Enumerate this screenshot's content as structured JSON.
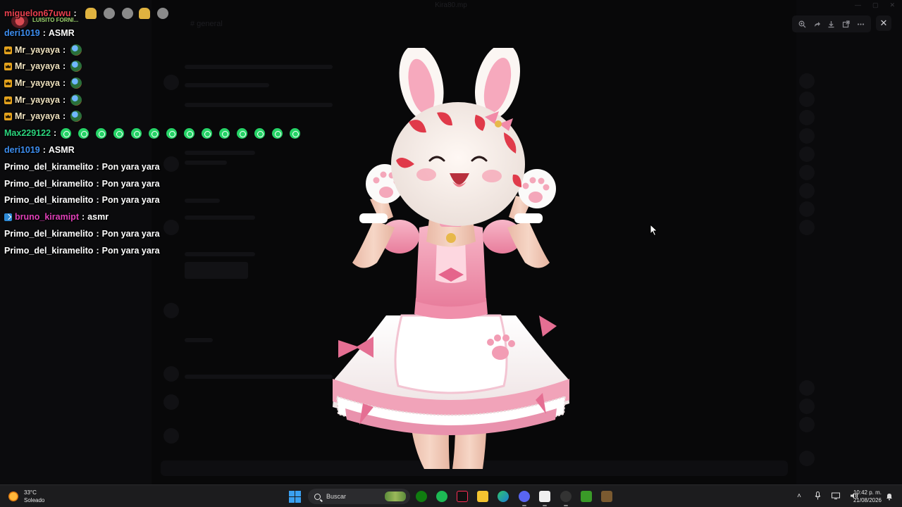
{
  "window": {
    "title": "Kira80.mp",
    "channel": "# general"
  },
  "viewer": {
    "close_glyph": "✕"
  },
  "chat": {
    "top_label": "LUISITO FORNI...",
    "top_user": "miguelon67uwu",
    "lines": [
      {
        "user": "deri1019",
        "color": "#3d8ef0",
        "badge": "",
        "text": "ASMR",
        "emote": ""
      },
      {
        "user": "Mr_yayaya",
        "color": "#f0e3c0",
        "badge": "crown",
        "text": "",
        "emote": "monkey"
      },
      {
        "user": "Mr_yayaya",
        "color": "#f0e3c0",
        "badge": "crown",
        "text": "",
        "emote": "monkey"
      },
      {
        "user": "Mr_yayaya",
        "color": "#f0e3c0",
        "badge": "crown",
        "text": "",
        "emote": "monkey"
      },
      {
        "user": "Mr_yayaya",
        "color": "#f0e3c0",
        "badge": "crown",
        "text": "",
        "emote": "monkey"
      },
      {
        "user": "Mr_yayaya",
        "color": "#f0e3c0",
        "badge": "crown",
        "text": "",
        "emote": "monkey"
      },
      {
        "user": "Max229122",
        "color": "#2bd47d",
        "badge": "",
        "text": "",
        "emote": "wa"
      },
      {
        "user": "deri1019",
        "color": "#3d8ef0",
        "badge": "",
        "text": "ASMR",
        "emote": ""
      },
      {
        "user": "Primo_del_kiramelito",
        "color": "#ffffff",
        "badge": "",
        "text": "Pon yara yara",
        "emote": ""
      },
      {
        "user": "Primo_del_kiramelito",
        "color": "#ffffff",
        "badge": "",
        "text": "Pon yara yara",
        "emote": ""
      },
      {
        "user": "Primo_del_kiramelito",
        "color": "#ffffff",
        "badge": "",
        "text": "Pon yara yara",
        "emote": ""
      },
      {
        "user": "bruno_kiramipt",
        "color": "#e040b8",
        "badge": "prime",
        "text": "asmr",
        "emote": ""
      },
      {
        "user": "Primo_del_kiramelito",
        "color": "#ffffff",
        "badge": "",
        "text": "Pon yara yara",
        "emote": ""
      },
      {
        "user": "Primo_del_kiramelito",
        "color": "#ffffff",
        "badge": "",
        "text": "Pon yara yara",
        "emote": ""
      }
    ]
  },
  "taskbar": {
    "weather_temp": "33°C",
    "weather_desc": "Soleado",
    "search_placeholder": "Buscar",
    "time": "10:42 p. m.",
    "date": "21/08/2026"
  }
}
